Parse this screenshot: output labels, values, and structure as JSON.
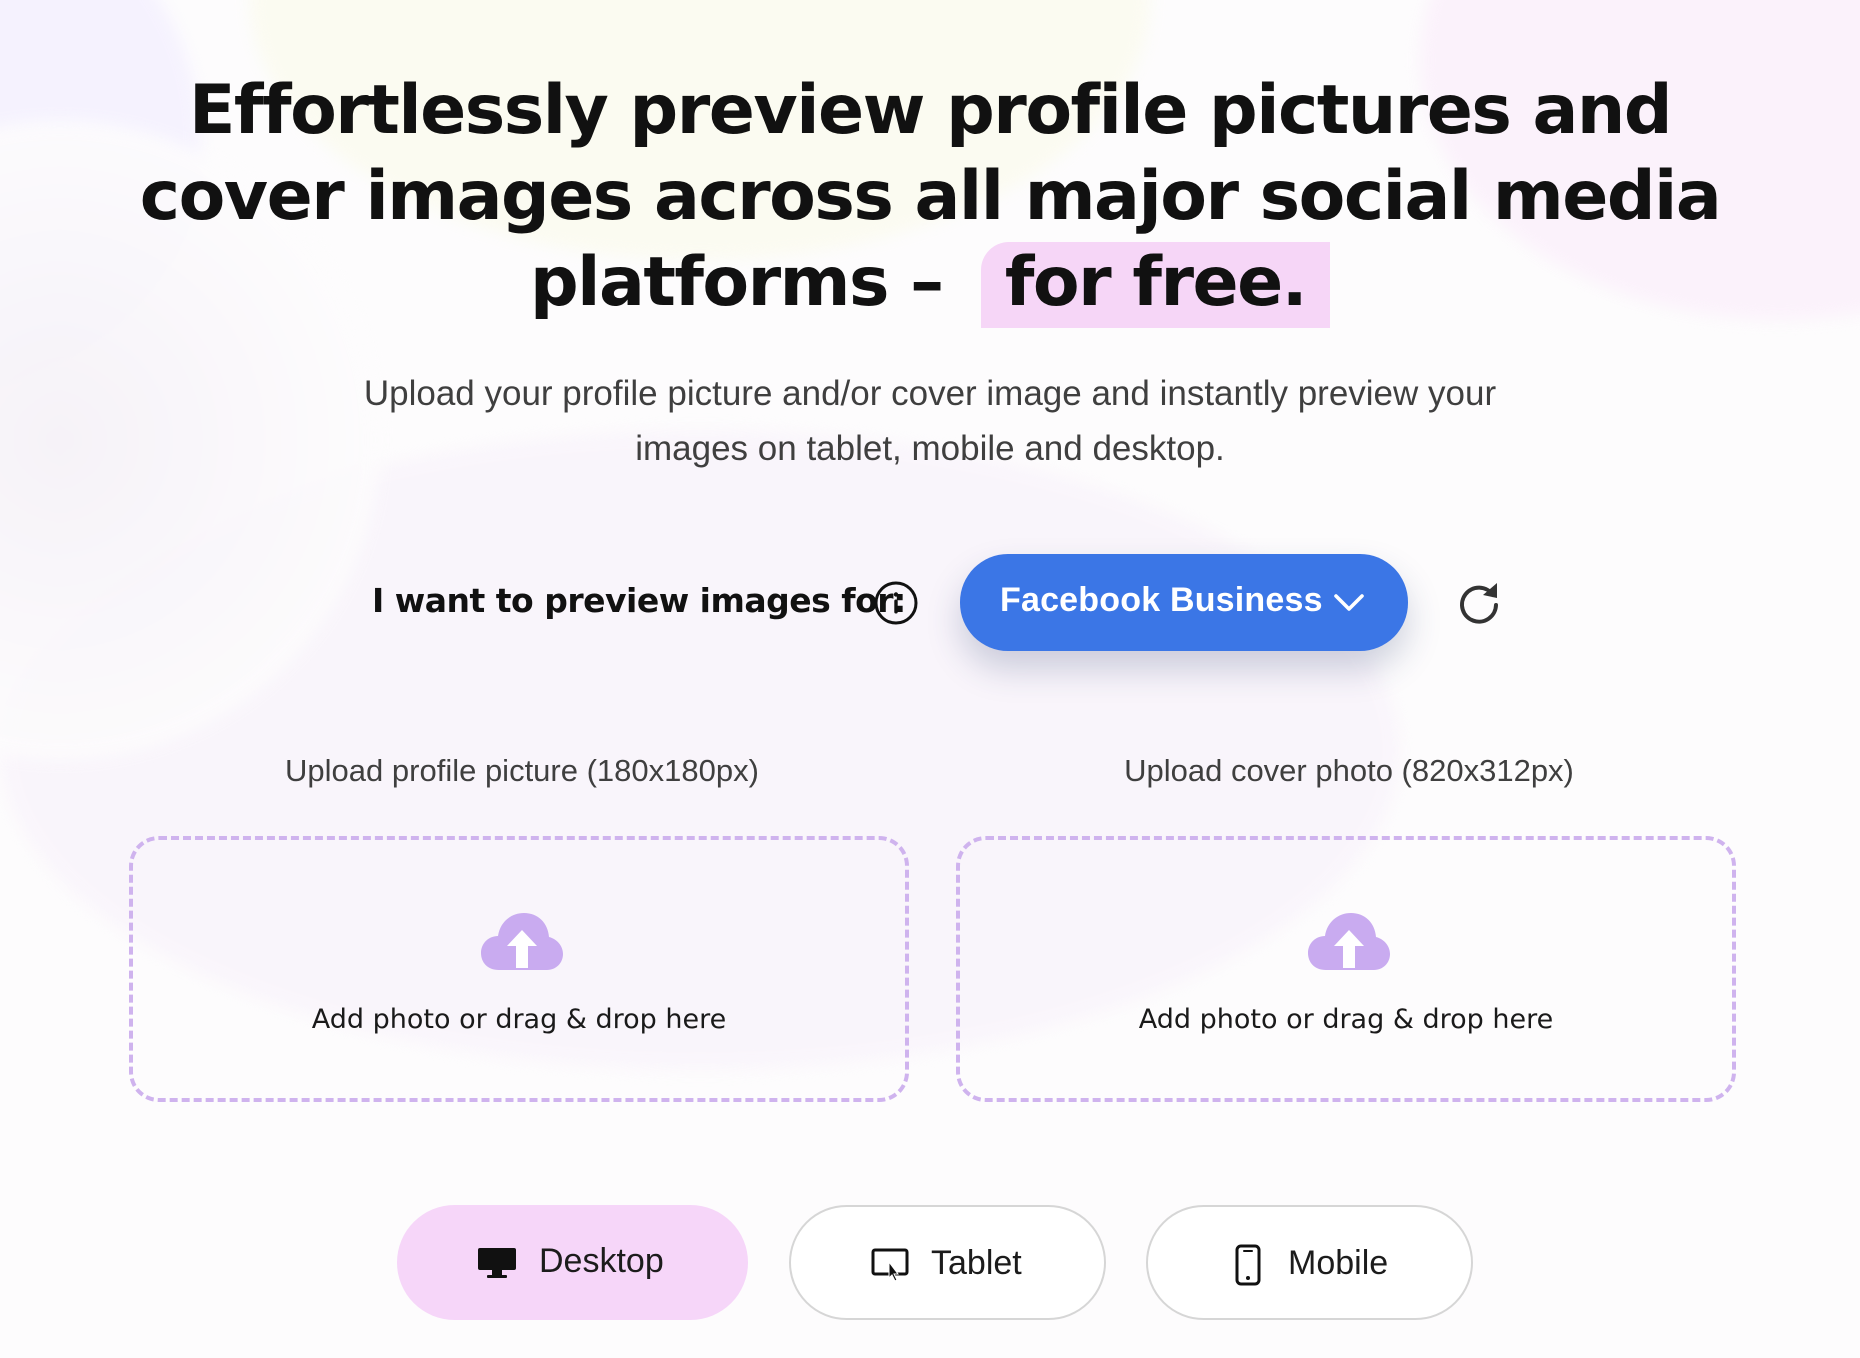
{
  "hero": {
    "title_main": "Effortlessly preview profile pictures and cover images across all major social media platforms – ",
    "title_highlight": "for free.",
    "subtitle": "Upload your profile picture and/or cover image and instantly preview your images on tablet, mobile and desktop."
  },
  "selector": {
    "label": "I want to preview images for:",
    "info_icon": "info-icon",
    "selected_platform": "Facebook Business",
    "dropdown_icon": "chevron-down-icon",
    "reset_icon": "refresh-icon",
    "accent_color": "#3b76e6"
  },
  "uploads": {
    "profile": {
      "label": "Upload profile picture (180x180px)",
      "prompt": "Add photo or drag & drop here",
      "icon": "cloud-upload-icon"
    },
    "cover": {
      "label": "Upload cover photo (820x312px)",
      "prompt": "Add photo or drag & drop here",
      "icon": "cloud-upload-icon"
    },
    "border_color": "#cfb3ee"
  },
  "devices": {
    "selected": "Desktop",
    "selected_color": "#f6d6f9",
    "items": [
      {
        "label": "Desktop",
        "icon": "desktop-icon"
      },
      {
        "label": "Tablet",
        "icon": "tablet-icon"
      },
      {
        "label": "Mobile",
        "icon": "mobile-icon"
      }
    ]
  }
}
